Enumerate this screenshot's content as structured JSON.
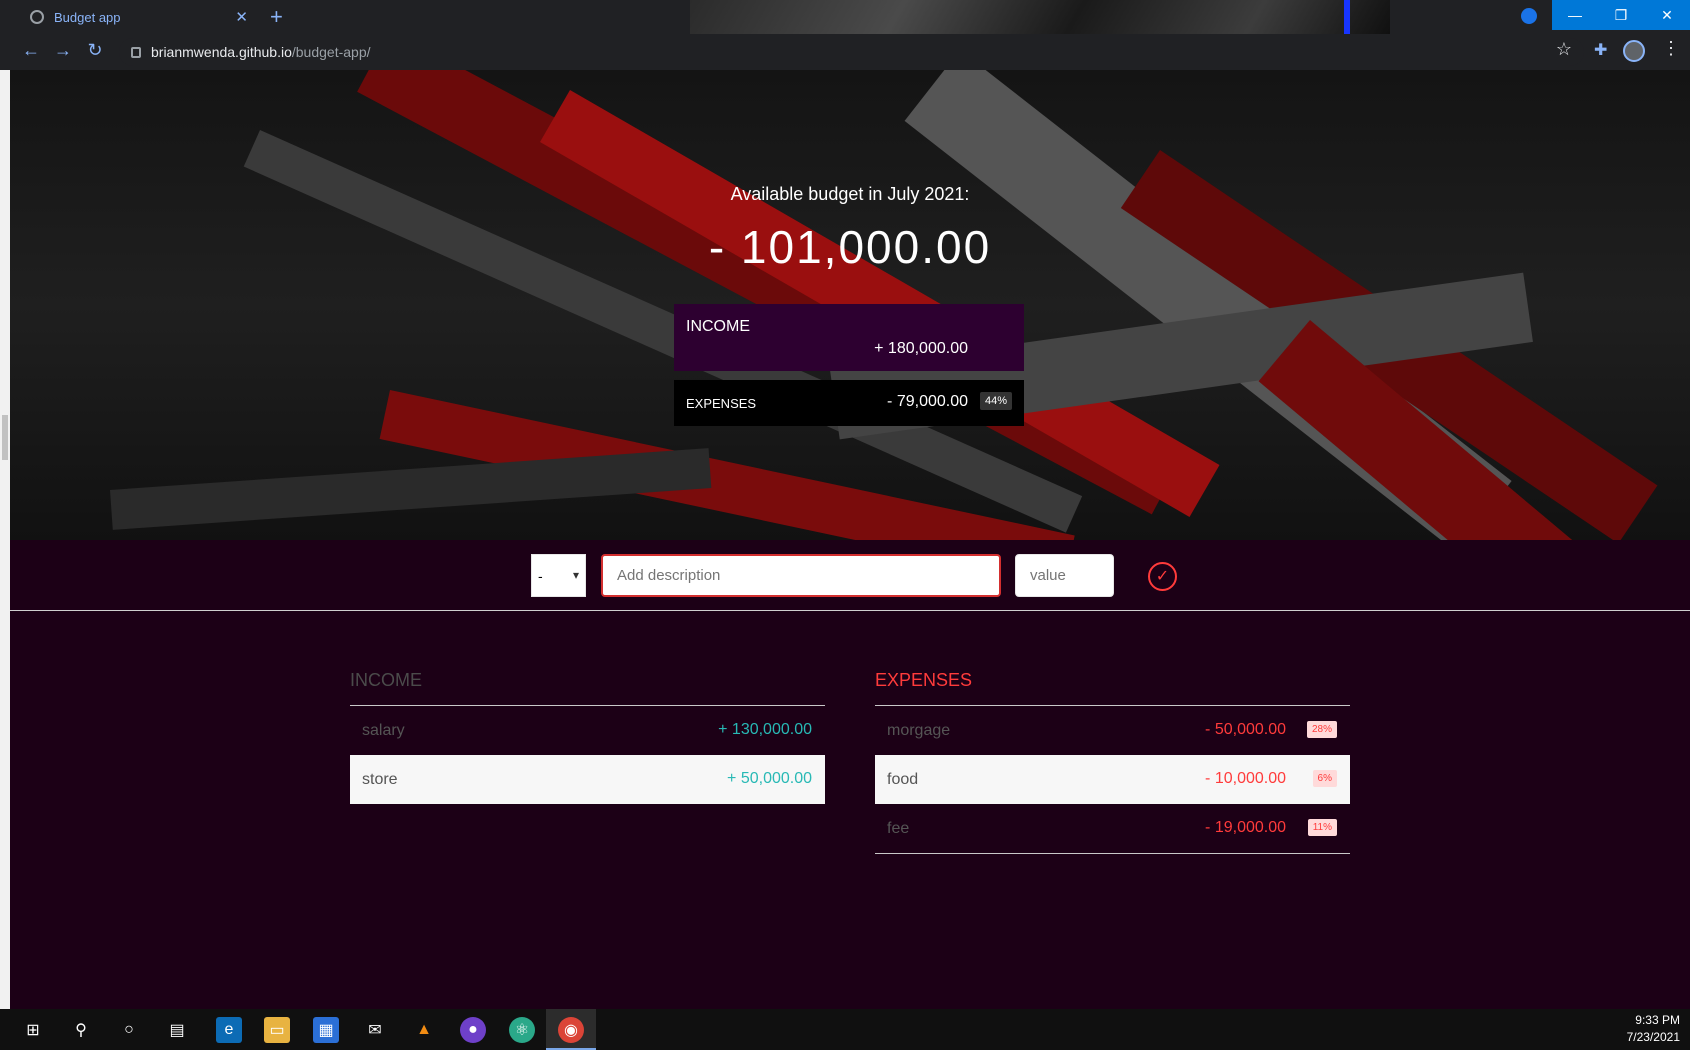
{
  "browser": {
    "tab_title": "Budget app",
    "tab_close": "✕",
    "new_tab": "+",
    "url_host": "brianmwenda.github.io",
    "url_path": "/budget-app/",
    "window_minimize": "—",
    "window_restore": "❐",
    "window_close": "✕"
  },
  "hero": {
    "title": "Available budget in July 2021:",
    "value": "- 101,000.00",
    "income_label": "INCOME",
    "income_value": "+ 180,000.00",
    "expenses_label": "EXPENSES",
    "expenses_value": "- 79,000.00",
    "expenses_percentage": "44%"
  },
  "add_form": {
    "type_value": "-",
    "description_placeholder": "Add description",
    "value_placeholder": "value",
    "submit_icon": "check-circle-icon"
  },
  "income": {
    "title": "INCOME",
    "items": [
      {
        "description": "salary",
        "value": "+ 130,000.00"
      },
      {
        "description": "store",
        "value": "+ 50,000.00"
      }
    ]
  },
  "expenses": {
    "title": "EXPENSES",
    "items": [
      {
        "description": "morgage",
        "value": "- 50,000.00",
        "percentage": "28%"
      },
      {
        "description": "food",
        "value": "- 10,000.00",
        "percentage": "6%"
      },
      {
        "description": "fee",
        "value": "- 19,000.00",
        "percentage": "11%"
      }
    ]
  },
  "taskbar": {
    "time": "9:33 PM",
    "date": "7/23/2021"
  },
  "colors": {
    "page_background": "#1c0016",
    "income_box": "#2d0030",
    "expense_red": "#ff3b3b",
    "income_teal": "#28b9b5"
  }
}
